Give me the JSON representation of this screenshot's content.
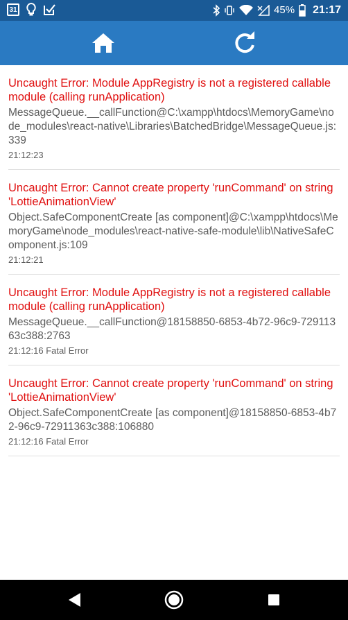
{
  "status_bar": {
    "calendar_day": "31",
    "battery_percent": "45%",
    "time": "21:17",
    "icons": [
      "calendar-icon",
      "lightbulb-icon",
      "checkbox-icon",
      "bluetooth-icon",
      "vibrate-icon",
      "wifi-icon",
      "signal-icon",
      "battery-icon"
    ]
  },
  "toolbar": {
    "icons": [
      "home-icon",
      "refresh-icon"
    ],
    "color": "#2a7ac2"
  },
  "errors": [
    {
      "title": "Uncaught Error: Module AppRegistry is not a registered callable module (calling runApplication)",
      "stack": "MessageQueue.__callFunction@C:\\xampp\\htdocs\\MemoryGame\\node_modules\\react-native\\Libraries\\BatchedBridge\\MessageQueue.js:339",
      "meta": "21:12:23"
    },
    {
      "title": "Uncaught Error: Cannot create property 'runCommand' on string 'LottieAnimationView'",
      "stack": "Object.SafeComponentCreate [as component]@C:\\xampp\\htdocs\\MemoryGame\\node_modules\\react-native-safe-module\\lib\\NativeSafeComponent.js:109",
      "meta": "21:12:21"
    },
    {
      "title": "Uncaught Error: Module AppRegistry is not a registered callable module (calling runApplication)",
      "stack": "MessageQueue.__callFunction@18158850-6853-4b72-96c9-72911363c388:2763",
      "meta": "21:12:16 Fatal Error"
    },
    {
      "title": "Uncaught Error: Cannot create property 'runCommand' on string 'LottieAnimationView'",
      "stack": "Object.SafeComponentCreate [as component]@18158850-6853-4b72-96c9-72911363c388:106880",
      "meta": "21:12:16 Fatal Error"
    }
  ],
  "navigation_bar": {
    "icons": [
      "back-icon",
      "home-circle-icon",
      "recents-icon"
    ]
  },
  "colors": {
    "error_red": "#e01010",
    "status_bar": "#1a5a96",
    "text_gray": "#5c5c5c"
  }
}
